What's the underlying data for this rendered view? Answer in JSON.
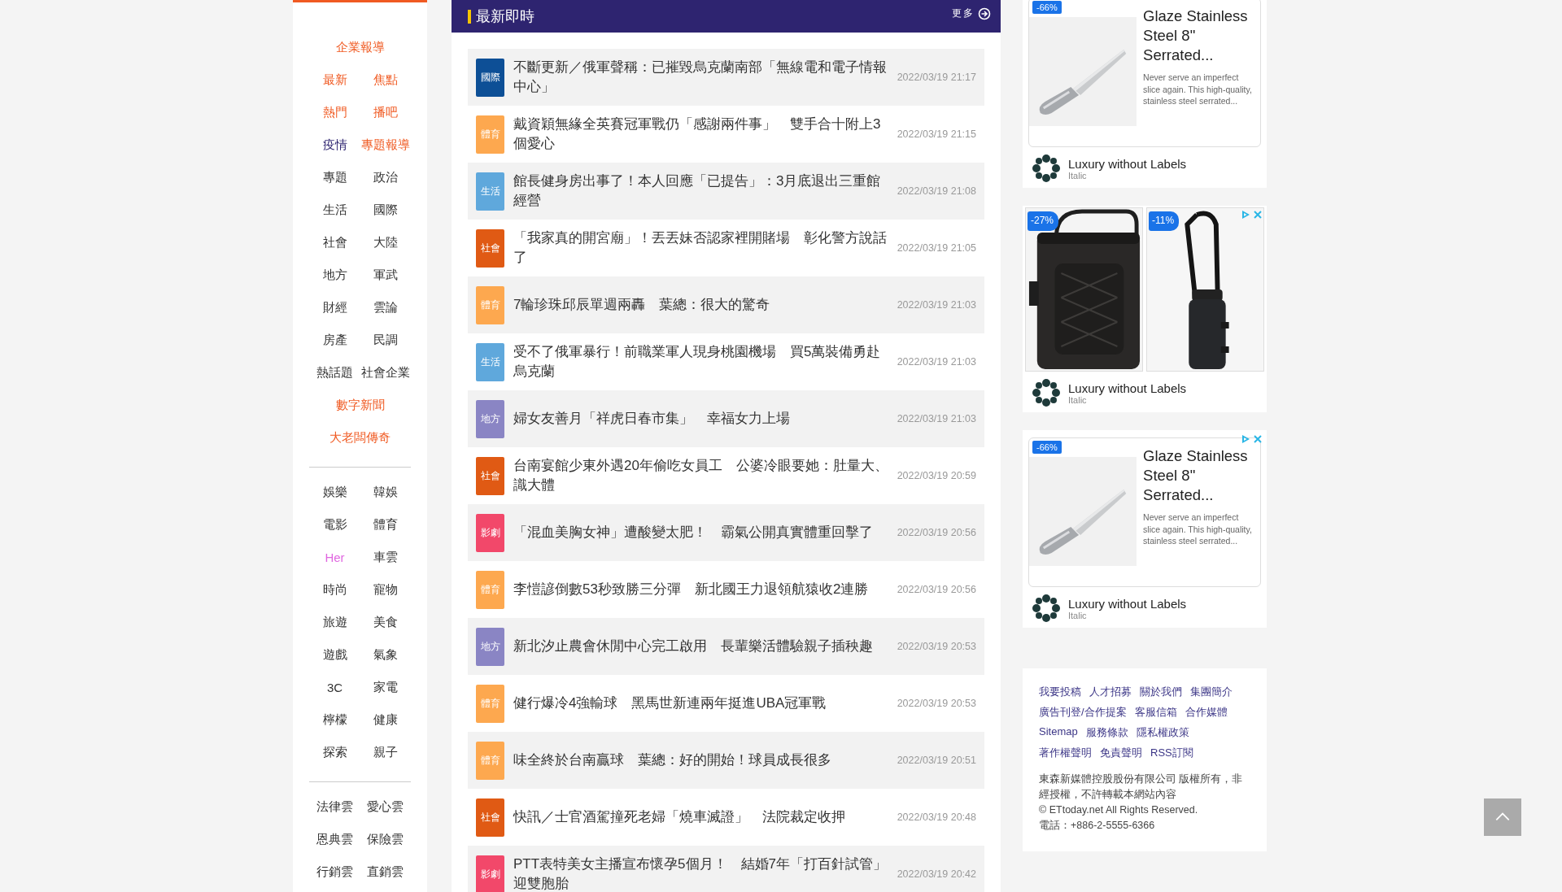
{
  "sidebar": {
    "groups": [
      [
        [
          {
            "label": "企業報導",
            "color": "#f05a22"
          }
        ],
        [
          {
            "label": "最新",
            "color": "#f05a22"
          },
          {
            "label": "焦點",
            "color": "#f05a22"
          }
        ],
        [
          {
            "label": "熱門",
            "color": "#f05a22"
          },
          {
            "label": "播吧",
            "color": "#f05a22"
          }
        ],
        [
          {
            "label": "疫情",
            "color": "#2e2470"
          },
          {
            "label": "專題報導",
            "color": "#f05a22"
          }
        ],
        [
          {
            "label": "專題"
          },
          {
            "label": "政治"
          }
        ],
        [
          {
            "label": "生活"
          },
          {
            "label": "國際"
          }
        ],
        [
          {
            "label": "社會"
          },
          {
            "label": "大陸"
          }
        ],
        [
          {
            "label": "地方"
          },
          {
            "label": "軍武"
          }
        ],
        [
          {
            "label": "財經"
          },
          {
            "label": "雲論"
          }
        ],
        [
          {
            "label": "房產"
          },
          {
            "label": "民調"
          }
        ],
        [
          {
            "label": "熱話題"
          },
          {
            "label": "社會企業"
          }
        ],
        [
          {
            "label": "數字新聞",
            "color": "#f05a22"
          }
        ],
        [
          {
            "label": "大老闆傳奇",
            "color": "#f05a22"
          }
        ]
      ],
      [
        [
          {
            "label": "娛樂"
          },
          {
            "label": "韓娛"
          }
        ],
        [
          {
            "label": "電影"
          },
          {
            "label": "體育"
          }
        ],
        [
          {
            "label": "Her",
            "color": "#e066e0"
          },
          {
            "label": "車雲"
          }
        ],
        [
          {
            "label": "時尚"
          },
          {
            "label": "寵物"
          }
        ],
        [
          {
            "label": "旅遊"
          },
          {
            "label": "美食"
          }
        ],
        [
          {
            "label": "遊戲"
          },
          {
            "label": "氣象"
          }
        ],
        [
          {
            "label": "3C"
          },
          {
            "label": "家電"
          }
        ],
        [
          {
            "label": "檸檬"
          },
          {
            "label": "健康"
          }
        ],
        [
          {
            "label": "探索"
          },
          {
            "label": "親子"
          }
        ]
      ],
      [
        [
          {
            "label": "法律雲"
          },
          {
            "label": "愛心雲"
          }
        ],
        [
          {
            "label": "恩典雲"
          },
          {
            "label": "保險雲"
          }
        ],
        [
          {
            "label": "行銷雲"
          },
          {
            "label": "直銷雲"
          }
        ]
      ]
    ]
  },
  "news": {
    "title": "最新即時",
    "more": "更多",
    "items": [
      {
        "tag": "國際",
        "color": "#0d4f96",
        "headline": "不斷更新／俄軍聲稱：已摧毀烏克蘭南部「無線電和電子情報中心」",
        "time": "2022/03/19 21:17"
      },
      {
        "tag": "體育",
        "color": "#fda84f",
        "headline": "戴資穎無緣全英賽冠軍戰仍「感謝兩件事」　雙手合十附上3個愛心",
        "time": "2022/03/19 21:15"
      },
      {
        "tag": "生活",
        "color": "#5fa8dc",
        "headline": "館長健身房出事了！本人回應「已提告」：3月底退出三重館經營",
        "time": "2022/03/19 21:08"
      },
      {
        "tag": "社會",
        "color": "#e05a14",
        "headline": "「我家真的開宮廟」！丟丟妹否認家裡開賭場　彰化警方說話了",
        "time": "2022/03/19 21:05"
      },
      {
        "tag": "體育",
        "color": "#fda84f",
        "headline": "7輪珍珠邱辰單週兩轟　葉總：很大的驚奇",
        "time": "2022/03/19 21:03"
      },
      {
        "tag": "生活",
        "color": "#5fa8dc",
        "headline": "受不了俄軍暴行！前職業軍人現身桃園機場　買5萬裝備勇赴烏克蘭",
        "time": "2022/03/19 21:03"
      },
      {
        "tag": "地方",
        "color": "#8a85c4",
        "headline": "婦女友善月「祥虎日春市集」　幸福女力上場",
        "time": "2022/03/19 21:03"
      },
      {
        "tag": "社會",
        "color": "#e05a14",
        "headline": "台南宴館少東外遇20年偷吃女員工　公婆冷眼要她：肚量大、識大體",
        "time": "2022/03/19 20:59"
      },
      {
        "tag": "影劇",
        "color": "#f2486a",
        "headline": "「混血美胸女神」遭酸變太肥！　霸氣公開真實體重回擊了",
        "time": "2022/03/19 20:56"
      },
      {
        "tag": "體育",
        "color": "#fda84f",
        "headline": "李愷諺倒數53秒致勝三分彈　新北國王力退領航猿收2連勝",
        "time": "2022/03/19 20:56"
      },
      {
        "tag": "地方",
        "color": "#8a85c4",
        "headline": "新北汐止農會休閒中心完工啟用　長輩樂活體驗親子插秧趣",
        "time": "2022/03/19 20:53"
      },
      {
        "tag": "體育",
        "color": "#fda84f",
        "headline": "健行爆冷4強輸球　黑馬世新連兩年挺進UBA冠軍戰",
        "time": "2022/03/19 20:53"
      },
      {
        "tag": "體育",
        "color": "#fda84f",
        "headline": "味全終於台南贏球　葉總：好的開始！球員成長很多",
        "time": "2022/03/19 20:51"
      },
      {
        "tag": "社會",
        "color": "#e05a14",
        "headline": "快訊／士官酒駕撞死老婦「燒車滅證」　法院裁定收押",
        "time": "2022/03/19 20:48"
      },
      {
        "tag": "影劇",
        "color": "#f2486a",
        "headline": "PTT表特美女主播宣布懷孕5個月！　結婚7年「打百針試管」迎雙胞胎",
        "time": "2022/03/19 20:42"
      }
    ]
  },
  "ads": [
    {
      "kind": "product",
      "badges": [
        "-66%"
      ],
      "title": "Glaze Stainless Steel 8\" Serrated...",
      "description": "Never serve an imperfect slice again. This high-quality, stainless steel serrated...",
      "advertiser": "Luxury without Labels",
      "subtitle": "Italic",
      "ad_controls": false
    },
    {
      "kind": "gallery",
      "badges": [
        "-27%",
        "-11%"
      ],
      "advertiser": "Luxury without Labels",
      "subtitle": "Italic",
      "ad_controls": true
    },
    {
      "kind": "product",
      "badges": [
        "-66%"
      ],
      "title": "Glaze Stainless Steel 8\" Serrated...",
      "description": "Never serve an imperfect slice again. This high-quality, stainless steel serrated...",
      "advertiser": "Luxury without Labels",
      "subtitle": "Italic",
      "ad_controls": true
    }
  ],
  "footer": {
    "link_rows": [
      [
        "我要投稿",
        "人才招募",
        "關於我們",
        "集團簡介"
      ],
      [
        "廣告刊登/合作提案",
        "客服信箱",
        "合作媒體"
      ],
      [
        "Sitemap",
        "服務條款",
        "隱私權政策"
      ],
      [
        "著作權聲明",
        "免責聲明",
        "RSS訂閱"
      ]
    ],
    "copyright": "東森新媒體控股股份有限公司 版權所有，非經授權，不許轉載本網站內容",
    "rights": "© ETtoday.net All Rights Reserved.",
    "phone": "電話：+886-2-5555-6366"
  }
}
